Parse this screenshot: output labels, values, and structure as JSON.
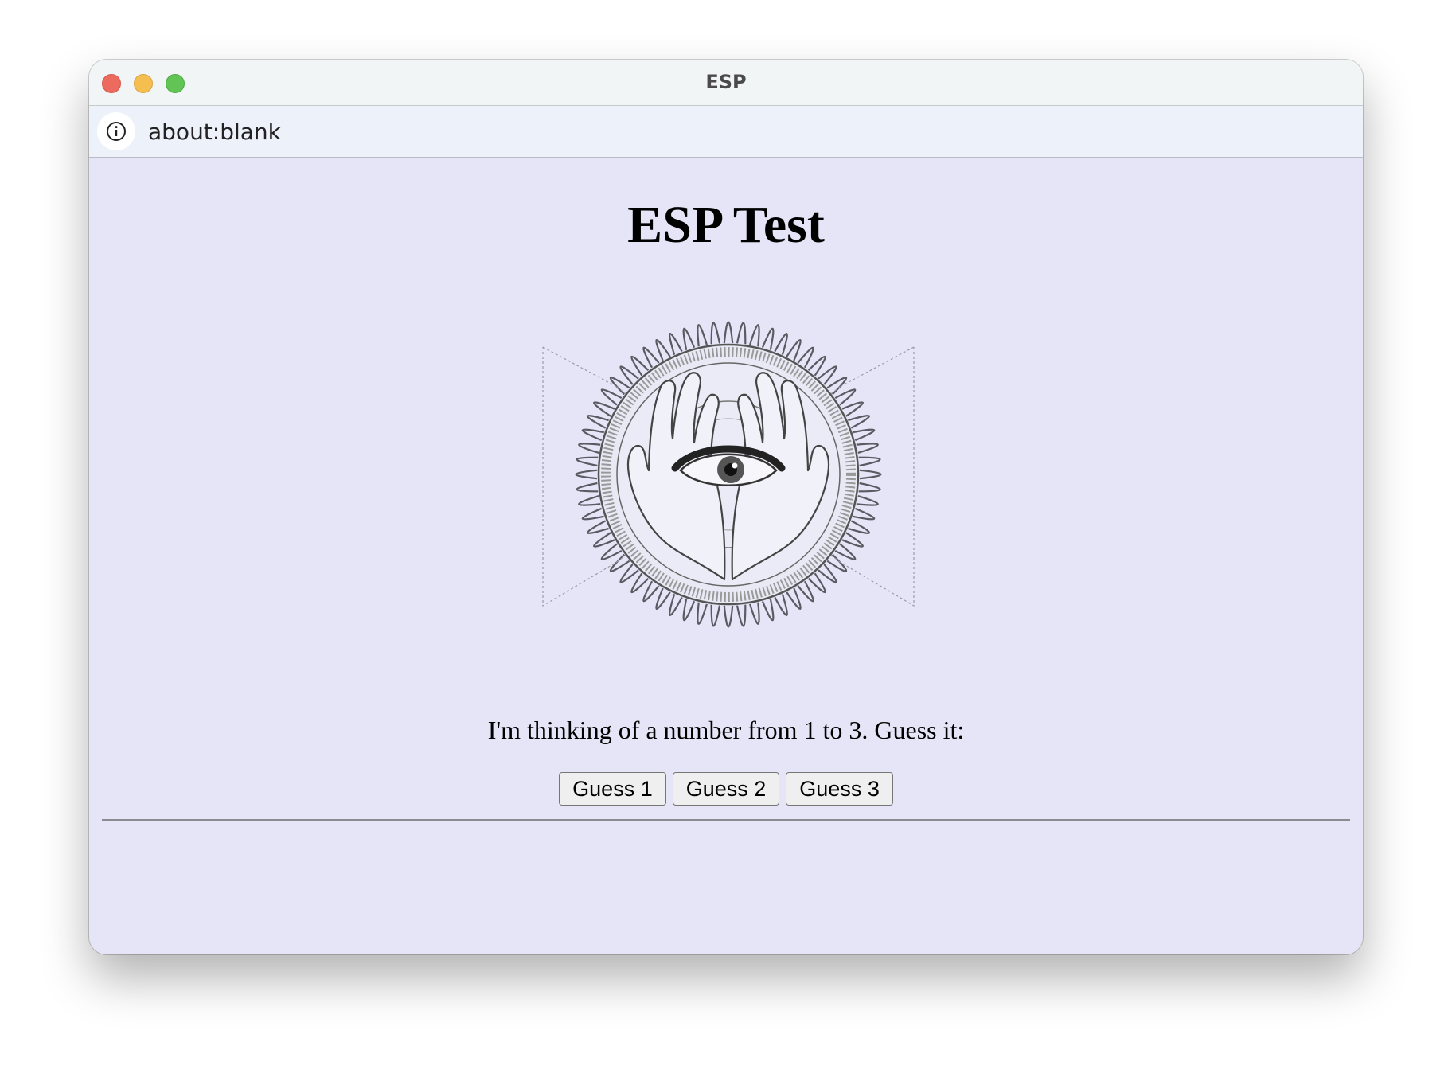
{
  "window": {
    "title": "ESP"
  },
  "address_bar": {
    "url": "about:blank",
    "info_icon": "info-circle-icon"
  },
  "page": {
    "heading": "ESP Test",
    "emblem_icon": "eye-in-hands-emblem",
    "prompt": "I'm thinking of a number from 1 to 3. Guess it:",
    "buttons": [
      {
        "label": "Guess 1"
      },
      {
        "label": "Guess 2"
      },
      {
        "label": "Guess 3"
      }
    ]
  },
  "colors": {
    "page_background": "#e5e5f7",
    "titlebar_background": "#f2f5f6",
    "urlbar_background": "#edf1f9",
    "close": "#ed6a5e",
    "minimize": "#f5bf4f",
    "zoom": "#61c454"
  }
}
